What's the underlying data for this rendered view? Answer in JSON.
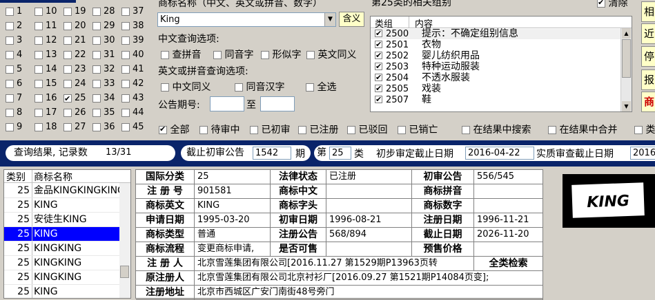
{
  "class_grid": {
    "cells": [
      {
        "n": "1",
        "on": false
      },
      {
        "n": "10",
        "on": false
      },
      {
        "n": "19",
        "on": false
      },
      {
        "n": "28",
        "on": false
      },
      {
        "n": "37",
        "on": false
      },
      {
        "n": "2",
        "on": false
      },
      {
        "n": "11",
        "on": false
      },
      {
        "n": "20",
        "on": false
      },
      {
        "n": "29",
        "on": false
      },
      {
        "n": "38",
        "on": false
      },
      {
        "n": "3",
        "on": false
      },
      {
        "n": "12",
        "on": false
      },
      {
        "n": "21",
        "on": false
      },
      {
        "n": "30",
        "on": false
      },
      {
        "n": "39",
        "on": false
      },
      {
        "n": "4",
        "on": false
      },
      {
        "n": "13",
        "on": false
      },
      {
        "n": "22",
        "on": false
      },
      {
        "n": "31",
        "on": false
      },
      {
        "n": "40",
        "on": false
      },
      {
        "n": "5",
        "on": false
      },
      {
        "n": "14",
        "on": false
      },
      {
        "n": "23",
        "on": false
      },
      {
        "n": "32",
        "on": false
      },
      {
        "n": "41",
        "on": false
      },
      {
        "n": "6",
        "on": false
      },
      {
        "n": "15",
        "on": false
      },
      {
        "n": "24",
        "on": false
      },
      {
        "n": "33",
        "on": false
      },
      {
        "n": "42",
        "on": false
      },
      {
        "n": "7",
        "on": false
      },
      {
        "n": "16",
        "on": false
      },
      {
        "n": "25",
        "on": true
      },
      {
        "n": "34",
        "on": false
      },
      {
        "n": "43",
        "on": false
      },
      {
        "n": "8",
        "on": false
      },
      {
        "n": "17",
        "on": false
      },
      {
        "n": "26",
        "on": false
      },
      {
        "n": "35",
        "on": false
      },
      {
        "n": "44",
        "on": false
      },
      {
        "n": "9",
        "on": false
      },
      {
        "n": "18",
        "on": false
      },
      {
        "n": "27",
        "on": false
      },
      {
        "n": "36",
        "on": false
      },
      {
        "n": "45",
        "on": false
      }
    ]
  },
  "query": {
    "name_label": "商标名称（中文、英文或拼音、数字）",
    "name_value": "King",
    "hanyi_button": "含义",
    "cn_options_label": "中文查询选项:",
    "cn_options": [
      "查拼音",
      "同音字",
      "形似字",
      "英文同义"
    ],
    "en_options_label": "英文或拼音查询选项:",
    "en_options": [
      "中文同义",
      "同音汉字",
      "全选"
    ],
    "issue_label": "公告期号:",
    "issue_to": "至"
  },
  "groups": {
    "title": "第25类的相关组别",
    "clear_label": "清除",
    "clear_checked": true,
    "col_group": "类组",
    "col_content": "内容",
    "rows": [
      {
        "code": "2500",
        "desc": "提示：不确定组别信息",
        "on": true
      },
      {
        "code": "2501",
        "desc": "衣物",
        "on": true
      },
      {
        "code": "2502",
        "desc": "婴儿纺织用品",
        "on": true
      },
      {
        "code": "2503",
        "desc": "特种运动服装",
        "on": true
      },
      {
        "code": "2504",
        "desc": "不透水服装",
        "on": true
      },
      {
        "code": "2505",
        "desc": "戏装",
        "on": true
      },
      {
        "code": "2507",
        "desc": "鞋",
        "on": true
      }
    ]
  },
  "side_buttons": [
    "相",
    "近",
    "停",
    "报",
    "商"
  ],
  "filters": {
    "items": [
      {
        "label": "全部",
        "on": true
      },
      {
        "label": "待审中",
        "on": false
      },
      {
        "label": "已初审",
        "on": false
      },
      {
        "label": "已注册",
        "on": false
      },
      {
        "label": "已驳回",
        "on": false
      },
      {
        "label": "已销亡",
        "on": false
      },
      {
        "label": "在结果中搜索",
        "on": false
      },
      {
        "label": "在结果中合并",
        "on": false
      },
      {
        "label": "类",
        "on": false
      }
    ]
  },
  "status": {
    "result_label": "查询结果, 记录数",
    "result_count": "13/31",
    "cutoff_label": "截止初审公告",
    "cutoff_issue": "1542",
    "period_label": "期",
    "class_prefix": "第",
    "class_num": "25",
    "class_suffix": "类",
    "prelim_label": "初步审定截止日期",
    "prelim_date": "2016-04-22",
    "exam_label": "实质审查截止日期",
    "exam_date": "2016"
  },
  "results": {
    "col_class": "类别",
    "col_name": "商标名称",
    "rows": [
      {
        "cls": "25",
        "name": "金品KINGKINGKING",
        "sel": false
      },
      {
        "cls": "25",
        "name": "KING",
        "sel": false
      },
      {
        "cls": "25",
        "name": "安徒生KING",
        "sel": false
      },
      {
        "cls": "25",
        "name": "KING",
        "sel": true
      },
      {
        "cls": "25",
        "name": "KINGKING",
        "sel": false
      },
      {
        "cls": "25",
        "name": "KINGKING",
        "sel": false
      },
      {
        "cls": "25",
        "name": "KINGKING",
        "sel": false
      },
      {
        "cls": "25",
        "name": "KING",
        "sel": false
      }
    ]
  },
  "detail": {
    "intl_class_k": "国际分类",
    "intl_class_v": "25",
    "legal_status_k": "法律状态",
    "legal_status_v": "已注册",
    "prelim_pub_k": "初审公告",
    "prelim_pub_v": "556/545",
    "reg_no_k": "注 册 号",
    "reg_no_v": "901581",
    "cn_name_k": "商标中文",
    "cn_name_v": "",
    "pinyin_k": "商标拼音",
    "pinyin_v": "",
    "en_name_k": "商标英文",
    "en_name_v": "KING",
    "head_k": "商标字头",
    "head_v": "",
    "digit_k": "商标数字",
    "digit_v": "",
    "apply_date_k": "申请日期",
    "apply_date_v": "1995-03-20",
    "prelim_date_k": "初审日期",
    "prelim_date_v": "1996-08-21",
    "reg_date_k": "注册日期",
    "reg_date_v": "1996-11-21",
    "type_k": "商标类型",
    "type_v": "普通",
    "reg_pub_k": "注册公告",
    "reg_pub_v": "568/894",
    "expire_k": "截止日期",
    "expire_v": "2026-11-20",
    "flow_k": "商标流程",
    "flow_v": "变更商标申请,",
    "sellable_k": "是否可售",
    "sellable_v": "",
    "price_k": "预售价格",
    "price_v": "",
    "registrant_k": "注 册 人",
    "registrant_v": "北京雪莲集团有限公司[2016.11.27 第1529期P13963页转",
    "full_search": "全类检索",
    "orig_reg_k": "原注册人",
    "orig_reg_v": "北京雪莲集团有限公司北京衬衫厂[2016.09.27 第1521期P14084页变];",
    "address_k": "注册地址",
    "address_v": "北京市西城区广安门南街48号旁门"
  },
  "logo": {
    "text": "KING"
  }
}
